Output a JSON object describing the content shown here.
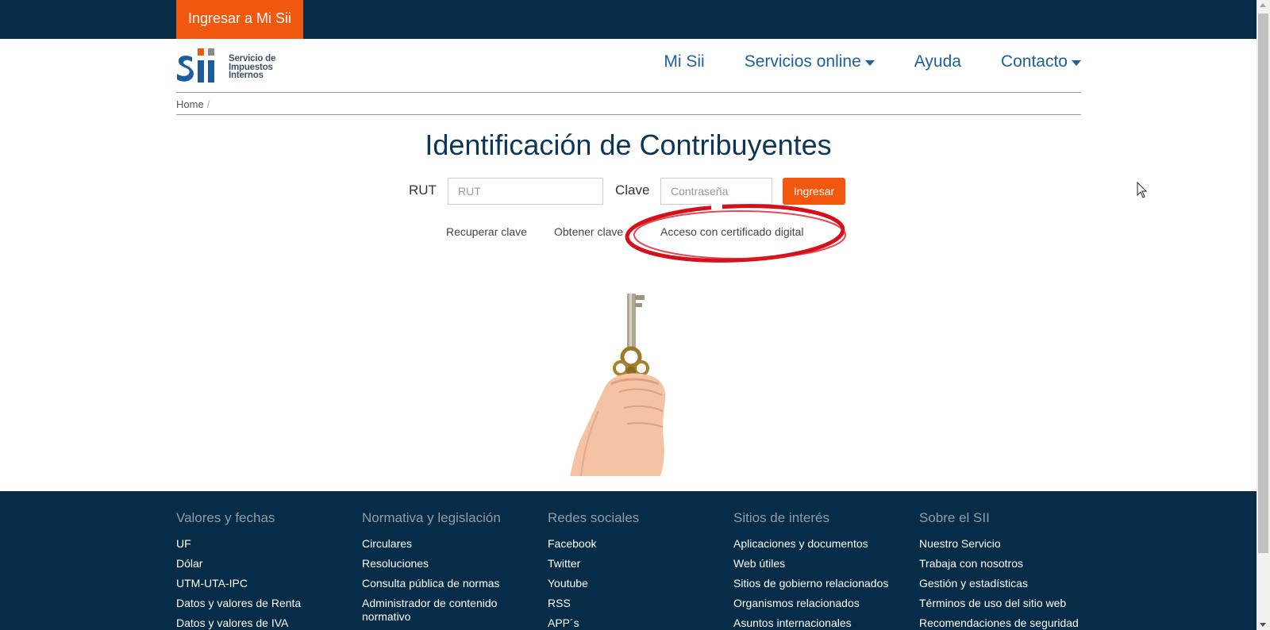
{
  "topbar": {
    "login_button": "Ingresar a Mi Sii"
  },
  "logo": {
    "line1": "Servicio de",
    "line2": "Impuestos",
    "line3": "Internos"
  },
  "nav": {
    "items": [
      {
        "label": "Mi Sii",
        "dropdown": false
      },
      {
        "label": "Servicios online",
        "dropdown": true
      },
      {
        "label": "Ayuda",
        "dropdown": false
      },
      {
        "label": "Contacto",
        "dropdown": true
      }
    ]
  },
  "breadcrumb": {
    "home": "Home",
    "separator": "/"
  },
  "login": {
    "title": "Identificación de Contribuyentes",
    "rut_label": "RUT",
    "rut_placeholder": "RUT",
    "clave_label": "Clave",
    "clave_placeholder": "Contraseña",
    "submit_label": "Ingresar",
    "links": {
      "recover": "Recuperar clave",
      "obtain": "Obtener clave",
      "certificate": "Acceso con certificado digital"
    }
  },
  "footer": {
    "columns": [
      {
        "heading": "Valores y fechas",
        "links": [
          "UF",
          "Dólar",
          "UTM-UTA-IPC",
          "Datos y valores de Renta",
          "Datos y valores de IVA"
        ]
      },
      {
        "heading": "Normativa y legislación",
        "links": [
          "Circulares",
          "Resoluciones",
          "Consulta pública de normas",
          "Administrador de contenido normativo"
        ]
      },
      {
        "heading": "Redes sociales",
        "links": [
          "Facebook",
          "Twitter",
          "Youtube",
          "RSS",
          "APP´s"
        ]
      },
      {
        "heading": "Sitios de interés",
        "links": [
          "Aplicaciones y documentos",
          "Web útiles",
          "Sitios de gobierno relacionados",
          "Organismos relacionados",
          "Asuntos internacionales"
        ]
      },
      {
        "heading": "Sobre el SII",
        "links": [
          "Nuestro Servicio",
          "Trabaja con nosotros",
          "Gestión y estadísticas",
          "Términos de uso del sitio web",
          "Recomendaciones de seguridad"
        ]
      }
    ]
  },
  "colors": {
    "dark_navy": "#062c47",
    "brand_orange": "#f2570f",
    "nav_blue": "#1e5fa0",
    "annotation_red": "#d6101a"
  },
  "icons": {
    "dropdown": "caret-down-icon",
    "cursor": "mouse-pointer-icon",
    "illustration": "hand-holding-key-image"
  }
}
